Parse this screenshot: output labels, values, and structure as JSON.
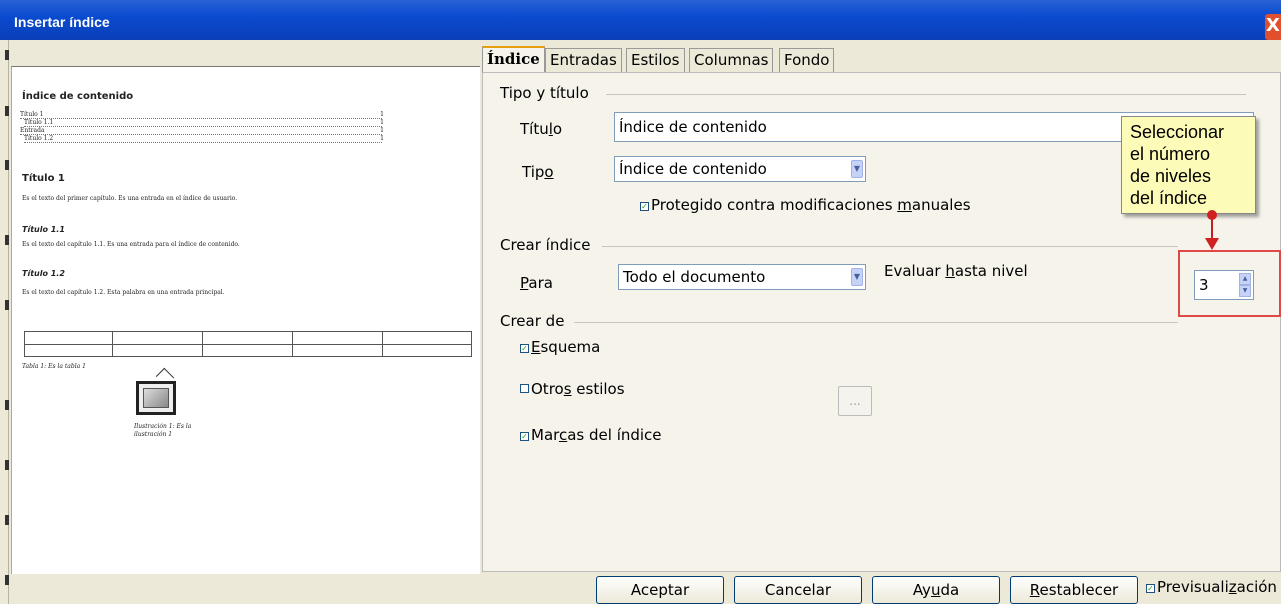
{
  "window": {
    "title": "Insertar índice",
    "close_symbol": "X"
  },
  "preview": {
    "heading": "Índice de contenido",
    "toc": [
      {
        "text": "Título 1",
        "page": "1"
      },
      {
        "text": "Título 1.1",
        "page": "1"
      },
      {
        "text": "Entrada",
        "page": "1"
      },
      {
        "text": "Título 1.2",
        "page": "1"
      }
    ],
    "h1": "Título 1",
    "p1": "Es el texto del primer capítulo. Es una entrada en el índice de usuario.",
    "h2": "Título 1.1",
    "p2": "Es el texto del capítulo 1.1. Es una entrada para el índice de contenido.",
    "h3": "Título 1.2",
    "p3": "Es el texto del capítulo 1.2. Esta palabra en una entrada principal.",
    "table_caption": "Tabla 1: Es la tabla 1",
    "figure_caption_1": "Ilustración 1: Es la",
    "figure_caption_2": "ilustración 1"
  },
  "tabs": [
    "Índice",
    "Entradas",
    "Estilos",
    "Columnas",
    "Fondo"
  ],
  "section_type": {
    "label": "Tipo y título",
    "title_label": "Título",
    "title_value": "Índice de contenido",
    "type_label": "Tipo",
    "type_value": "Índice de contenido",
    "protected_label": "Protegido contra modificaciones manuales",
    "protected_checked": true
  },
  "section_create": {
    "label": "Crear índice",
    "for_label": "Para",
    "for_value": "Todo el documento",
    "eval_label": "Evaluar hasta nivel",
    "level_value": "3"
  },
  "section_from": {
    "label": "Crear de",
    "outline_label": "Esquema",
    "outline_checked": true,
    "other_styles_label": "Otros estilos",
    "other_styles_checked": false,
    "dots_label": "...",
    "marks_label": "Marcas del índice",
    "marks_checked": true
  },
  "callout": {
    "line1": "Seleccionar",
    "line2": "el número",
    "line3": "de niveles",
    "line4": "del índice"
  },
  "buttons": {
    "ok": "Aceptar",
    "cancel": "Cancelar",
    "help": "Ayuda",
    "reset": "Restablecer"
  },
  "preview_toggle": {
    "label": "Previsualización",
    "checked": true
  },
  "colors": {
    "titlebar": "#0a4bd0",
    "callout_bg": "#fdfbb8",
    "highlight_box": "#e04848"
  }
}
